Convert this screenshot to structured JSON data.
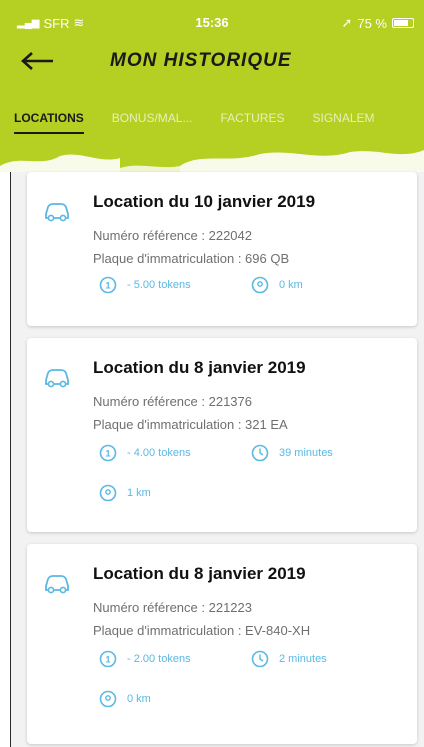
{
  "status_bar": {
    "carrier": "SFR",
    "time": "15:36",
    "battery": "75 %"
  },
  "header": {
    "title": "MON HISTORIQUE",
    "back_label": "←"
  },
  "tabs": [
    {
      "label": "LOCATIONS",
      "active": true
    },
    {
      "label": "BONUS/MAL...",
      "active": false
    },
    {
      "label": "FACTURES",
      "active": false
    },
    {
      "label": "SIGNALEM",
      "active": false
    }
  ],
  "colors": {
    "header": "#b5cf22",
    "accent": "#5bb8e3",
    "background": "#f2f2f2"
  },
  "rentals": [
    {
      "title": "Location du 10 janvier 2019",
      "reference": "Numéro référence : 222042",
      "plate": "Plaque d'immatriculation : 696 QB",
      "tokens": "- 5.00 tokens",
      "distance": "0 km"
    },
    {
      "title": "Location du 8 janvier 2019",
      "reference": "Numéro référence : 221376",
      "plate": "Plaque d'immatriculation : 321 EA",
      "tokens": "- 4.00 tokens",
      "duration": "39 minutes",
      "distance": "1 km"
    },
    {
      "title": "Location du 8 janvier 2019",
      "reference": "Numéro référence : 221223",
      "plate": "Plaque d'immatriculation : EV-840-XH",
      "tokens": "- 2.00 tokens",
      "duration": "2 minutes",
      "distance": "0 km"
    }
  ]
}
